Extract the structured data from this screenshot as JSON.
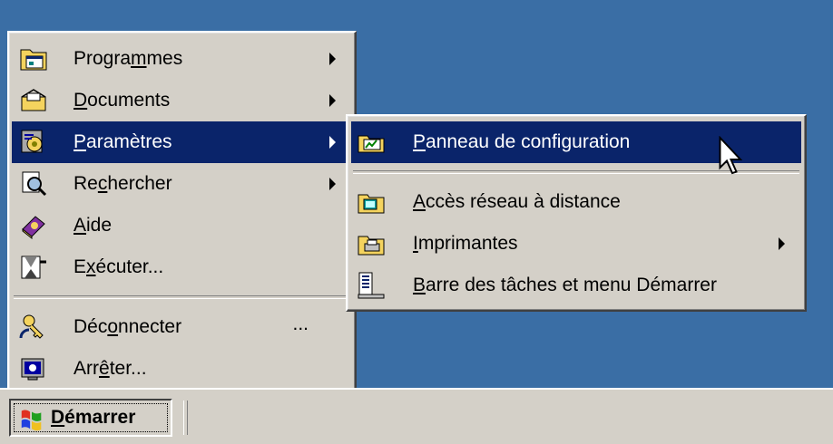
{
  "start_menu": {
    "items": [
      {
        "pre": "Progra",
        "key": "m",
        "post": "mes",
        "icon": "programs-folder-icon",
        "submenu": true
      },
      {
        "pre": "",
        "key": "D",
        "post": "ocuments",
        "icon": "documents-folder-icon",
        "submenu": true
      },
      {
        "pre": "",
        "key": "P",
        "post": "aramètres",
        "icon": "settings-icon",
        "submenu": true,
        "highlighted": true
      },
      {
        "pre": "Re",
        "key": "c",
        "post": "hercher",
        "icon": "search-icon",
        "submenu": true
      },
      {
        "pre": "",
        "key": "A",
        "post": "ide",
        "icon": "help-book-icon",
        "submenu": false
      },
      {
        "pre": "E",
        "key": "x",
        "post": "écuter...",
        "icon": "run-icon",
        "submenu": false
      },
      {
        "pre": "Déc",
        "key": "o",
        "post": "nnecter",
        "icon": "logoff-key-icon",
        "submenu": false,
        "trailing": "..."
      },
      {
        "pre": "Arr",
        "key": "ê",
        "post": "ter...",
        "icon": "shutdown-icon",
        "submenu": false
      }
    ]
  },
  "settings_submenu": {
    "items": [
      {
        "pre": "",
        "key": "P",
        "post": "anneau de configuration",
        "icon": "control-panel-icon",
        "highlighted": true
      },
      {
        "pre": "",
        "key": "A",
        "post": "ccès réseau à distance",
        "icon": "dialup-network-icon"
      },
      {
        "pre": "",
        "key": "I",
        "post": "mprimantes",
        "icon": "printers-folder-icon",
        "submenu": true
      },
      {
        "pre": "",
        "key": "B",
        "post": "arre des tâches et menu Démarrer",
        "icon": "taskbar-icon"
      }
    ]
  },
  "taskbar": {
    "start_pre": "",
    "start_key": "D",
    "start_post": "émarrer",
    "start_icon": "windows-logo-icon"
  },
  "colors": {
    "desktop": "#3a6ea5",
    "menu_face": "#d4d0c8",
    "highlight": "#0a246a"
  }
}
